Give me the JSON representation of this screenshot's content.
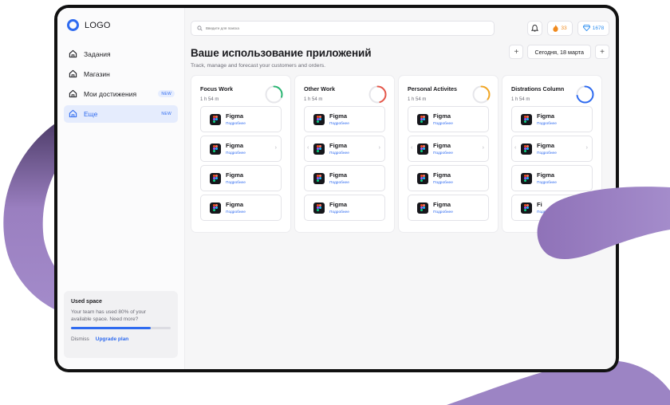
{
  "logo": {
    "text": "LOGO"
  },
  "sidebar": {
    "items": [
      {
        "label": "Задания",
        "icon": "home-icon",
        "badge": ""
      },
      {
        "label": "Магазин",
        "icon": "home-icon",
        "badge": ""
      },
      {
        "label": "Мои достижения",
        "icon": "home-icon",
        "badge": "NEW"
      },
      {
        "label": "Еще",
        "icon": "home-icon",
        "badge": "NEW",
        "active": true
      }
    ],
    "used_space": {
      "title": "Used space",
      "description": "Your team has used 80% of your available space. Need more?",
      "progress": 0.8,
      "dismiss_label": "Dismiss",
      "upgrade_label": "Upgrade plan"
    }
  },
  "topbar": {
    "search_placeholder": "Введите для поиска",
    "streak_count": "33",
    "gems_count": "1678"
  },
  "header": {
    "title": "Ваше использование приложений",
    "subtitle": "Track, manage and forecast your customers and orders.",
    "date_label": "Сегодня, 18 марта"
  },
  "columns": [
    {
      "title": "Focus Work",
      "time": "1 h 54 m",
      "ring_color": "#2bb673",
      "ring_progress": 0.3,
      "cards": [
        {
          "name": "Figma",
          "link": "Подробнее"
        },
        {
          "name": "Figma",
          "link": "Подробнее"
        },
        {
          "name": "Figma",
          "link": "Подробнее"
        },
        {
          "name": "Figma",
          "link": "Подробнее"
        }
      ]
    },
    {
      "title": "Other Work",
      "time": "1 h 54 m",
      "ring_color": "#e5574a",
      "ring_progress": 0.45,
      "cards": [
        {
          "name": "Figma",
          "link": "Подробнее"
        },
        {
          "name": "Figma",
          "link": "Подробнее"
        },
        {
          "name": "Figma",
          "link": "Подробнее"
        },
        {
          "name": "Figma",
          "link": "Подробнее"
        }
      ]
    },
    {
      "title": "Personal Activites",
      "time": "1 h 54 m",
      "ring_color": "#f2a623",
      "ring_progress": 0.35,
      "cards": [
        {
          "name": "Figma",
          "link": "Подробнее"
        },
        {
          "name": "Figma",
          "link": "Подробнее"
        },
        {
          "name": "Figma",
          "link": "Подробнее"
        },
        {
          "name": "Figma",
          "link": "Подробнее"
        }
      ]
    },
    {
      "title": "Distrations Column",
      "time": "1 h 54 m",
      "ring_color": "#2f6bf0",
      "ring_progress": 0.72,
      "cards": [
        {
          "name": "Figma",
          "link": "Подробнее"
        },
        {
          "name": "Figma",
          "link": "Подробнее"
        },
        {
          "name": "Figma",
          "link": "Подробнее"
        },
        {
          "name": "Fi",
          "link": "Подробнее"
        }
      ]
    }
  ],
  "colors": {
    "accent": "#2f6bf0",
    "decor": "#9b7fc0",
    "frame": "#111111"
  }
}
